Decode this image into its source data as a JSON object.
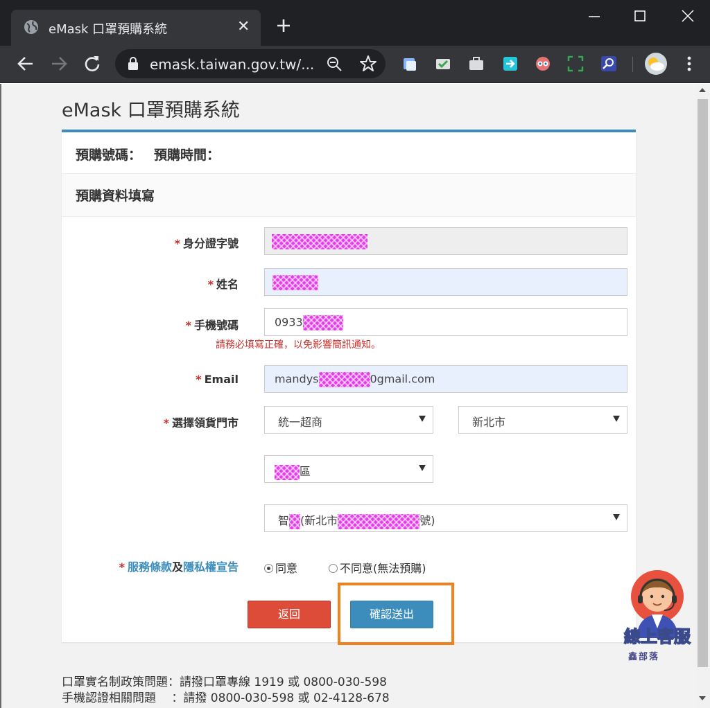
{
  "browser": {
    "tab_title": "eMask 口罩預購系統",
    "url": "emask.taiwan.gov.tw/..."
  },
  "page": {
    "title": "eMask 口罩預購系統",
    "order_number_label": "預購號碼：",
    "order_time_label": "預購時間：",
    "section_title": "預購資料填寫"
  },
  "form": {
    "id_label": "身分證字號",
    "name_label": "姓名",
    "phone_label": "手機號碼",
    "phone_value_prefix": "0933",
    "phone_hint": "請務必填寫正確，以免影響簡訊通知。",
    "email_label": "Email",
    "email_value_prefix": "mandys",
    "email_value_suffix": "0gmail.com",
    "store_label": "選擇領貨門市",
    "store_chain": "統一超商",
    "store_city": "新北市",
    "store_district_suffix": "區",
    "store_name_prefix": "智",
    "store_addr_prefix": "(新北市",
    "store_addr_suffix": "號)",
    "terms_service": "服務條款",
    "terms_and": "及",
    "terms_privacy": "隱私權宣告",
    "agree_label": "同意",
    "disagree_label": "不同意(無法預購)",
    "agree_selected": true,
    "back_button": "返回",
    "submit_button": "確認送出",
    "required_mark": "*"
  },
  "footer": {
    "line1": "口罩實名制政策問題：請撥口罩專線 1919 或 0800-030-598",
    "line2": "手機認證相關問題 　：請撥 0800-030-598 或 02-4128-678"
  },
  "widget": {
    "label": "線上客服",
    "brand": "鑫部落"
  },
  "colors": {
    "accent": "#3c8dbc",
    "danger": "#dd4b39",
    "highlight": "#f0811d",
    "mask": "#e23ee6"
  }
}
